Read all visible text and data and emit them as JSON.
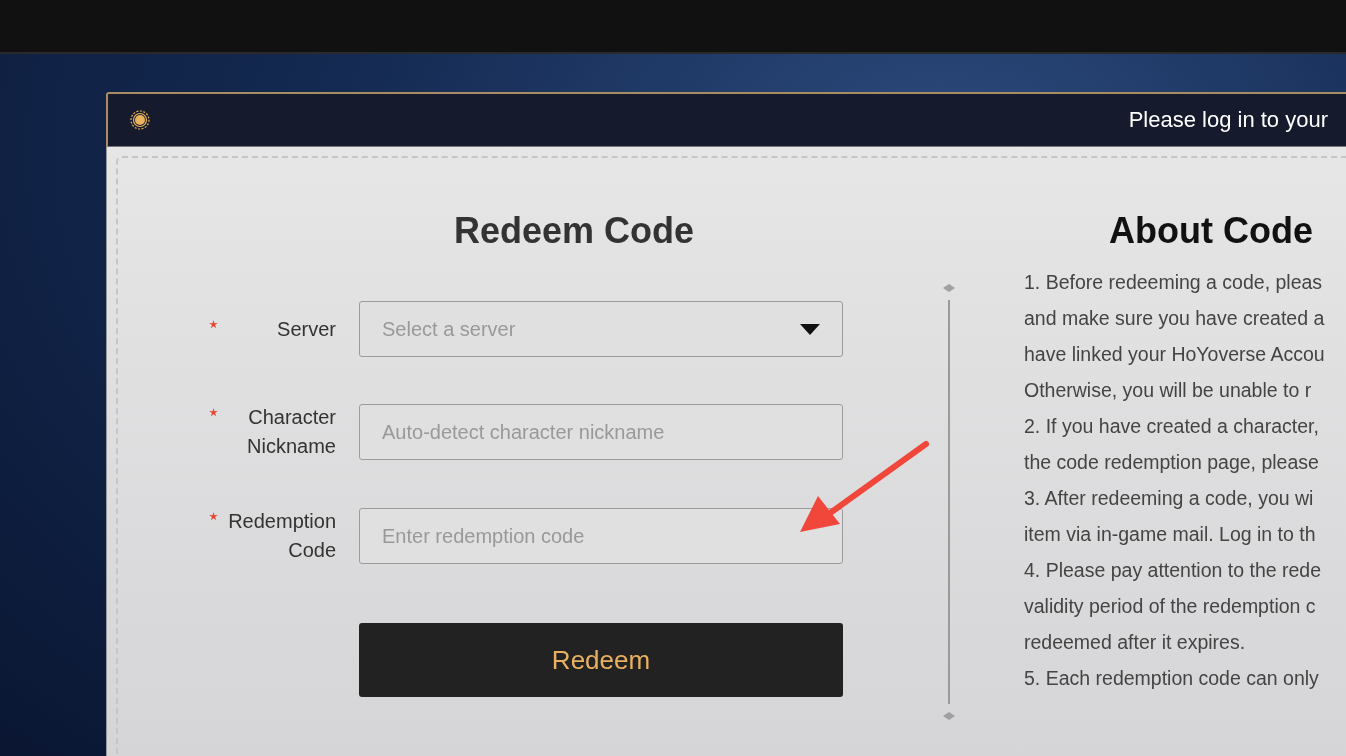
{
  "header": {
    "title": "Please log in to your"
  },
  "form": {
    "title": "Redeem Code",
    "fields": [
      {
        "label": "Server",
        "required": true,
        "kind": "select",
        "placeholder": "Select a server"
      },
      {
        "label": "Character Nickname",
        "required": true,
        "kind": "text",
        "placeholder": "Auto-detect character nickname"
      },
      {
        "label": "Redemption Code",
        "required": true,
        "kind": "text",
        "placeholder": "Enter redemption code"
      }
    ],
    "submit": "Redeem"
  },
  "about": {
    "title": "About Code",
    "lines": [
      "1. Before redeeming a code, pleas",
      "and make sure you have created a",
      "have linked your HoYoverse Accou",
      "Otherwise, you will be unable to r",
      "2. If you have created a character,",
      "the code redemption page, please",
      "3. After redeeming a code, you wi",
      "item via in-game mail. Log in to th",
      "4. Please pay attention to the rede",
      "validity period of the redemption c",
      "redeemed after it expires.",
      "5. Each redemption code can only"
    ]
  }
}
